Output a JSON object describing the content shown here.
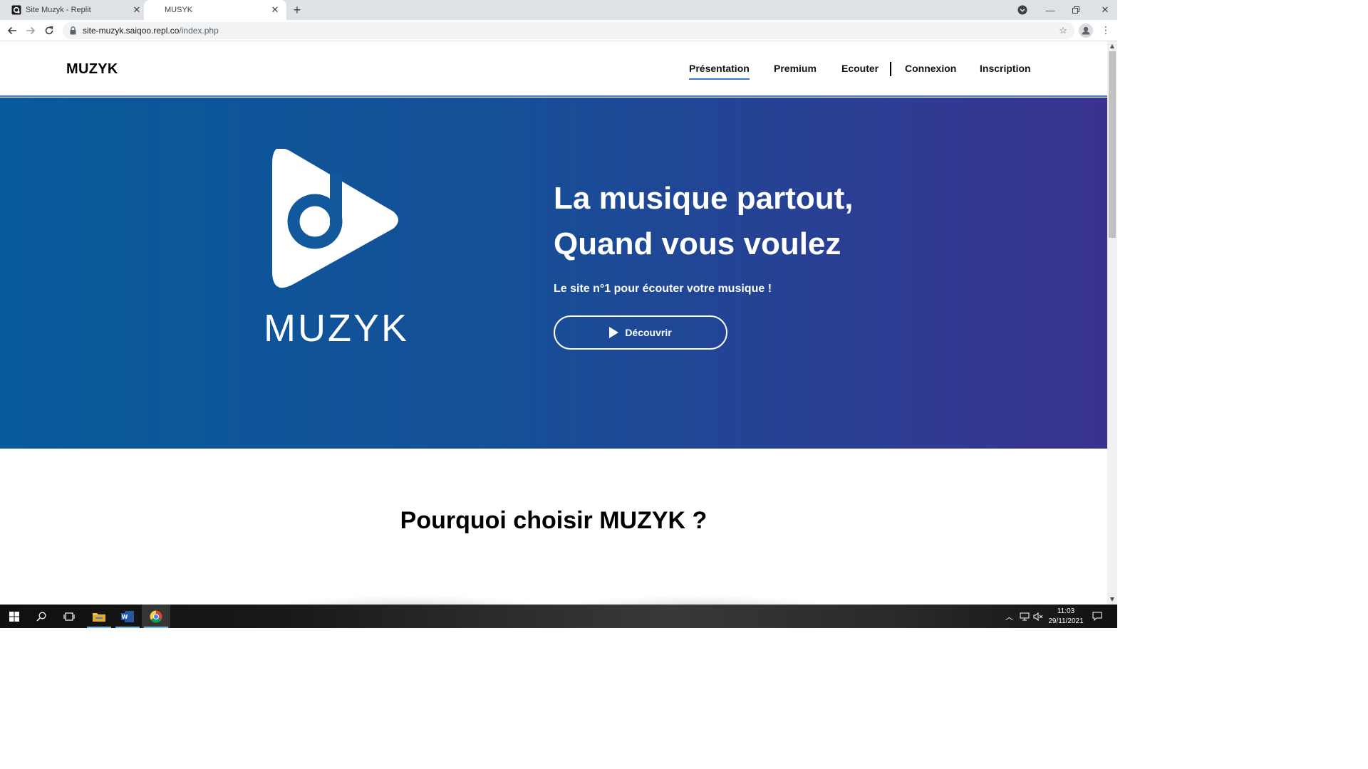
{
  "browser": {
    "tabs": [
      {
        "title": "Site Muzyk - Replit",
        "active": false
      },
      {
        "title": "MUSYK",
        "active": true
      }
    ],
    "url_host": "site-muzyk.saiqoo.repl.co",
    "url_path": "/index.php"
  },
  "site": {
    "brand": "MUZYK",
    "nav": [
      {
        "label": "Présentation",
        "active": true
      },
      {
        "label": "Premium",
        "active": false
      },
      {
        "label": "Ecouter",
        "active": false
      },
      {
        "label": "Connexion",
        "active": false
      },
      {
        "label": "Inscription",
        "active": false
      }
    ]
  },
  "hero": {
    "title_line1": "La musique partout,",
    "title_line2": "Quand vous voulez",
    "subtitle": "Le site n°1 pour écouter votre musique !",
    "cta_label": "Découvrir",
    "logo_word": "MUZYK",
    "colors": {
      "gradient_start": "#075a9b",
      "gradient_end": "#3a3291"
    }
  },
  "section": {
    "title": "Pourquoi choisir MUZYK ?"
  },
  "taskbar": {
    "time": "11:03",
    "date": "29/11/2021"
  }
}
